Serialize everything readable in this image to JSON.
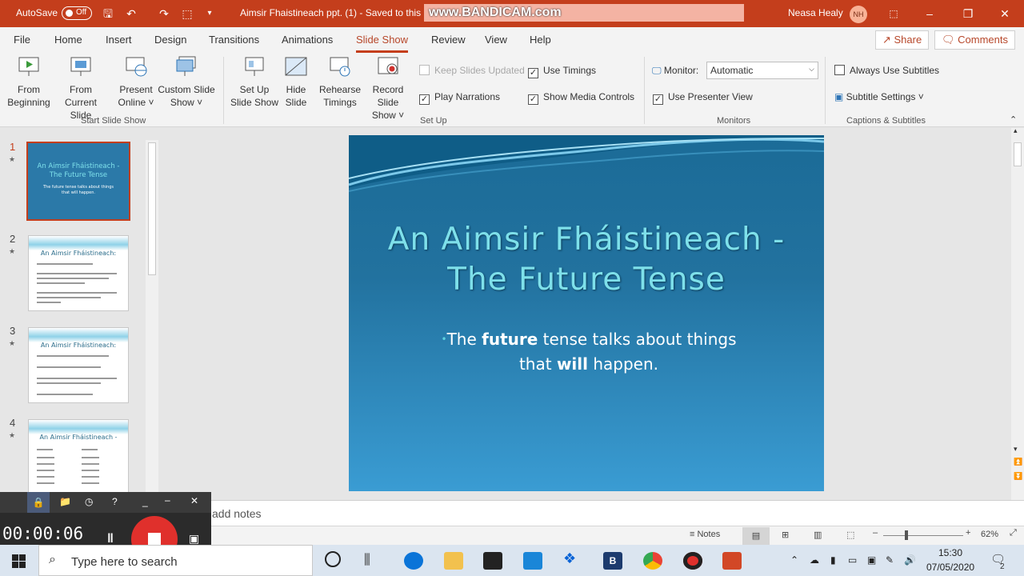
{
  "title_bar": {
    "autosave_label": "AutoSave",
    "autosave_state": "Off",
    "doc_title": "Aimsir Fhaistineach ppt. (1)  -  Saved to this P",
    "watermark": "www.BANDICAM.com",
    "user_name": "Neasa Healy",
    "user_initials": "NH"
  },
  "menu": {
    "tabs": [
      "File",
      "Home",
      "Insert",
      "Design",
      "Transitions",
      "Animations",
      "Slide Show",
      "Review",
      "View",
      "Help"
    ],
    "active_tab": "Slide Show",
    "share_label": "Share",
    "comments_label": "Comments"
  },
  "ribbon": {
    "start_group": {
      "label": "Start Slide Show",
      "from_beginning": [
        "From",
        "Beginning"
      ],
      "from_current": [
        "From",
        "Current Slide"
      ],
      "present_online": [
        "Present",
        "Online ˅"
      ],
      "custom_show": [
        "Custom Slide",
        "Show ˅"
      ]
    },
    "setup_group": {
      "label": "Set Up",
      "setup_show": [
        "Set Up",
        "Slide Show"
      ],
      "hide_slide": [
        "Hide",
        "Slide"
      ],
      "rehearse": [
        "Rehearse",
        "Timings"
      ],
      "record": [
        "Record Slide",
        "Show ˅"
      ],
      "keep_updated": "Keep Slides Updated",
      "play_narrations": "Play Narrations",
      "use_timings": "Use Timings",
      "show_media_controls": "Show Media Controls"
    },
    "monitors_group": {
      "label": "Monitors",
      "monitor_label": "Monitor:",
      "monitor_value": "Automatic",
      "presenter_view": "Use Presenter View"
    },
    "captions_group": {
      "label": "Captions & Subtitles",
      "always_subtitles": "Always Use Subtitles",
      "subtitle_settings": "Subtitle Settings ˅"
    }
  },
  "thumbnails": [
    {
      "num": "1",
      "title": "An Aimsir Fháistineach -\nThe Future Tense",
      "sub": "The future tense talks about things\nthat will happen."
    },
    {
      "num": "2",
      "title": "An Aimsir Fháistineach:"
    },
    {
      "num": "3",
      "title": "An Aimsir Fháistineach:"
    },
    {
      "num": "4",
      "title": "An Aimsir Fháistineach -"
    }
  ],
  "slide": {
    "title_line1": "An Aimsir Fháistineach -",
    "title_line2": "The Future Tense",
    "body_pre": "The ",
    "body_b1": "future",
    "body_mid": " tense talks about things",
    "body_line2_pre": "that ",
    "body_b2": "will",
    "body_post": " happen."
  },
  "notes_placeholder": "add notes",
  "status": {
    "notes_label": "Notes",
    "zoom": "62%"
  },
  "bandicam": {
    "timer": "00:00:06"
  },
  "taskbar": {
    "search_placeholder": "Type here to search",
    "time": "15:30",
    "date": "07/05/2020",
    "notif_count": "2"
  },
  "colors": {
    "accent": "#c43e1c",
    "slide_title": "#7ee0ea"
  }
}
